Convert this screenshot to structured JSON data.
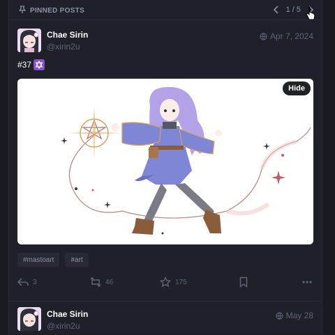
{
  "pinned": {
    "label": "Pinned posts",
    "pager": "1 / 5"
  },
  "post1": {
    "display_name": "Chae Sirin",
    "handle": "@xirin2u",
    "date": "Apr 7, 2024",
    "text": "#37",
    "media_hide_label": "Hide",
    "hashtags": [
      "#mastoart",
      "#art"
    ],
    "actions": {
      "reply_count": "3",
      "boost_count": "46",
      "favourite_count": "175"
    }
  },
  "post2": {
    "display_name": "Chae Sirin",
    "handle": "@xirin2u",
    "date": "May 28"
  },
  "colors": {
    "background": "#191b22",
    "column": "#1f2029",
    "muted_text": "#5f6378",
    "secondary_text": "#8d91a6",
    "emoji_purple": "#8a4fc8"
  }
}
